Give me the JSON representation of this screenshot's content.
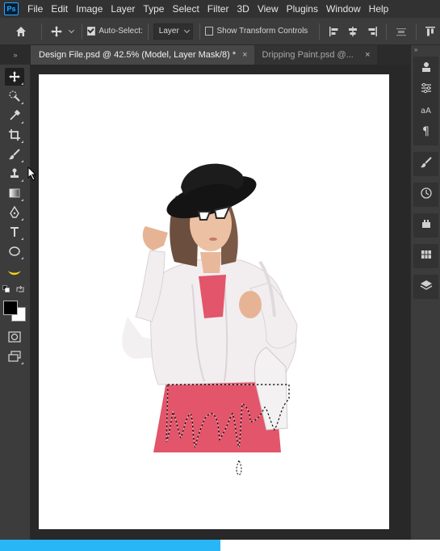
{
  "app": {
    "logo_text": "Ps"
  },
  "menu": {
    "items": [
      "File",
      "Edit",
      "Image",
      "Layer",
      "Type",
      "Select",
      "Filter",
      "3D",
      "View",
      "Plugins",
      "Window",
      "Help"
    ]
  },
  "options_bar": {
    "auto_select_label": "Auto-Select:",
    "auto_select_checked": true,
    "auto_select_target": "Layer",
    "show_transform_label": "Show Transform Controls",
    "show_transform_checked": false
  },
  "tabs": {
    "collapse_glyph": "»",
    "items": [
      {
        "label": "Design File.psd @ 42.5% (Model, Layer Mask/8) *",
        "active": true
      },
      {
        "label": "Dripping Paint.psd @...",
        "active": false
      }
    ],
    "close_glyph": "×"
  },
  "right_panel": {
    "collapse_glyph": "»"
  },
  "colors": {
    "foreground": "#000000",
    "background": "#ffffff",
    "accent": "#31a8ff",
    "progress": "#29b6f6"
  },
  "progress": {
    "fraction": 0.5
  },
  "toolbar": {
    "tools": [
      "move-icon",
      "quick-selection-icon",
      "eyedropper-icon",
      "crop-icon",
      "brush-icon",
      "clone-stamp-icon",
      "gradient-icon",
      "pen-icon",
      "type-icon",
      "ellipse-icon",
      "banana-icon"
    ]
  }
}
